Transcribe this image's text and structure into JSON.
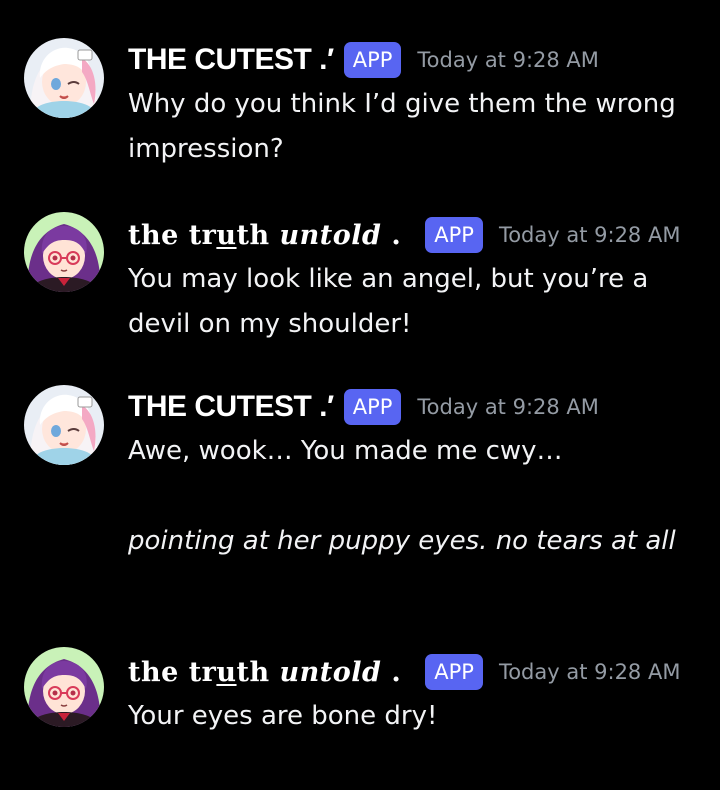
{
  "colors": {
    "background": "#000000",
    "text": "#f2f3f5",
    "timestamp": "#949ba4",
    "app_badge": "#5865f2"
  },
  "messages": [
    {
      "author": "THE CUTEST .′",
      "badge": "APP",
      "timestamp": "Today at 9:28 AM",
      "avatar_icon": "anime-girl-white-hair-avatar",
      "text": "Why do you think I’d give them the wrong impression?"
    },
    {
      "author_parts": [
        "the ",
        "tr",
        "u",
        "th ",
        "untold",
        " ."
      ],
      "badge": "APP",
      "timestamp": "Today at 9:28 AM",
      "avatar_icon": "anime-girl-purple-hair-avatar",
      "text": "You may look like an angel, but you’re a devil on my shoulder!"
    },
    {
      "author": "THE CUTEST .′",
      "badge": "APP",
      "timestamp": "Today at 9:28 AM",
      "avatar_icon": "anime-girl-white-hair-avatar",
      "text": "Awe, wook… You made me cwy…",
      "action_text": "pointing at her puppy eyes. no tears at all"
    },
    {
      "author_parts": [
        "the ",
        "tr",
        "u",
        "th ",
        "untold",
        " ."
      ],
      "badge": "APP",
      "timestamp": "Today at 9:28 AM",
      "avatar_icon": "anime-girl-purple-hair-avatar",
      "text": "Your eyes are bone dry!"
    }
  ]
}
